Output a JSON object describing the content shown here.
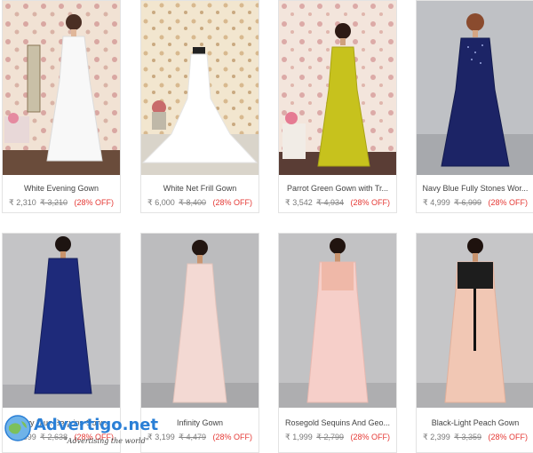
{
  "products": [
    {
      "name": "White Evening Gown",
      "price": "₹ 2,310",
      "mrp": "₹ 3,210",
      "discount": "(28% OFF)"
    },
    {
      "name": "White Net Frill Gown",
      "price": "₹ 6,000",
      "mrp": "₹ 8,400",
      "discount": "(28% OFF)"
    },
    {
      "name": "Parrot Green Gown with Tr...",
      "price": "₹ 3,542",
      "mrp": "₹ 4,934",
      "discount": "(28% OFF)"
    },
    {
      "name": "Navy Blue Fully Stones Wor...",
      "price": "₹ 4,999",
      "mrp": "₹ 6,999",
      "discount": "(28% OFF)"
    },
    {
      "name": "Navy Blue Sequins Gown",
      "price": "₹ 1,899",
      "mrp": "₹ 2,638",
      "discount": "(28% OFF)"
    },
    {
      "name": "Infinity Gown",
      "price": "₹ 3,199",
      "mrp": "₹ 4,479",
      "discount": "(28% OFF)"
    },
    {
      "name": "Rosegold Sequins And Geo...",
      "price": "₹ 1,999",
      "mrp": "₹ 2,799",
      "discount": "(28% OFF)"
    },
    {
      "name": "Black-Light Peach Gown",
      "price": "₹ 2,399",
      "mrp": "₹ 3,359",
      "discount": "(28% OFF)"
    }
  ],
  "watermark": {
    "brand": "Advertigo.net",
    "tagline": "\"Advertising the world\""
  },
  "colors": {
    "discount": "#e53935",
    "strike": "#888888",
    "brand": "#2a7fd6"
  }
}
